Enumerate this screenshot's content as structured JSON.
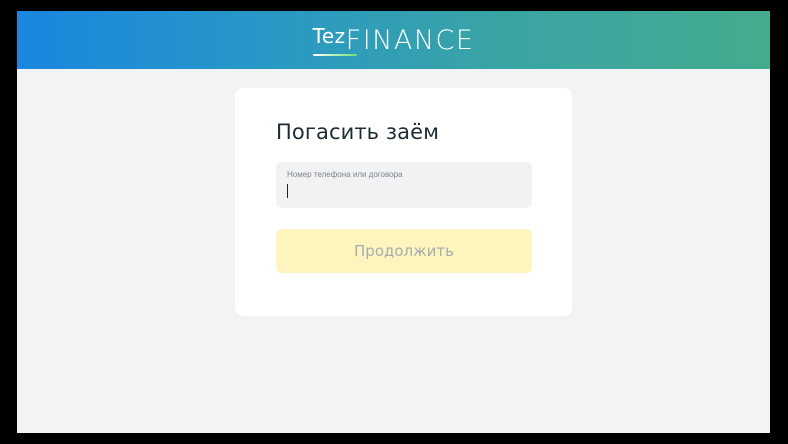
{
  "header": {
    "logo_part1": "Tez",
    "logo_part2": "FINANCE",
    "gradient_start": "#1a86e0",
    "gradient_end": "#45ab8e"
  },
  "card": {
    "title": "Погасить заём",
    "field": {
      "label": "Номер телефона или договора",
      "value": ""
    },
    "button_label": "Продолжить",
    "button_color": "#fdf5bd"
  }
}
